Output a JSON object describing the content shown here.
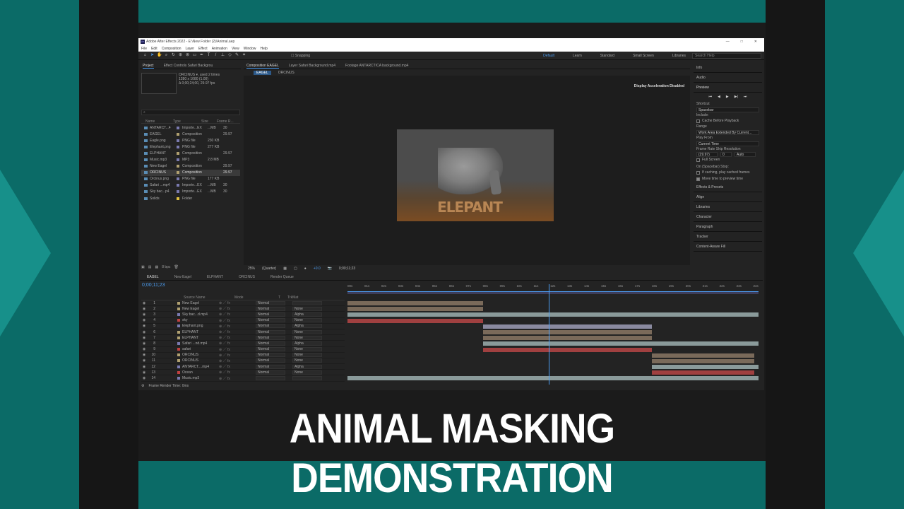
{
  "banner": "ANIMAL MASKING DEMONSTRATION",
  "window": {
    "title": "Adobe After Effects 2022 - E:\\New Folder (2)\\Animal.aep",
    "min": "—",
    "max": "□",
    "close": "✕"
  },
  "menu": [
    "File",
    "Edit",
    "Composition",
    "Layer",
    "Effect",
    "Animation",
    "View",
    "Window",
    "Help"
  ],
  "toolbar": {
    "snapping": "Snapping",
    "workspaces": [
      "Default",
      "Learn",
      "Standard",
      "Small Screen",
      "Libraries"
    ],
    "search_placeholder": "Search Help"
  },
  "project": {
    "tabs": [
      "Project",
      "Effect Controls Safari Backgrou"
    ],
    "info": [
      "ORCINUS ▾, used 2 times",
      "1280 x 1080 (1.00)",
      "Δ 0;00;24;00, 29.97 fps"
    ],
    "columns": [
      "Name",
      "Type",
      "Size",
      "Frame R..."
    ],
    "items": [
      {
        "name": "ANTARCT...4",
        "type": "Importe...EX",
        "size": "...MB",
        "fps": "30",
        "color": "#7a7ab0"
      },
      {
        "name": "EAGEL",
        "type": "Composition",
        "size": "",
        "fps": "29.97",
        "color": "#b0a070"
      },
      {
        "name": "Eagle.png",
        "type": "PNG file",
        "size": "230 KB",
        "fps": "",
        "color": "#7a7ab0"
      },
      {
        "name": "Elephant.png",
        "type": "PNG file",
        "size": "277 KB",
        "fps": "",
        "color": "#7a7ab0"
      },
      {
        "name": "ELPHANT",
        "type": "Composition",
        "size": "",
        "fps": "29.97",
        "color": "#b0a070"
      },
      {
        "name": "Music.mp3",
        "type": "MP3",
        "size": "2.8 MB",
        "fps": "",
        "color": "#7a7ab0"
      },
      {
        "name": "New Eagel",
        "type": "Composition",
        "size": "",
        "fps": "29.97",
        "color": "#b0a070"
      },
      {
        "name": "ORCINUS",
        "type": "Composition",
        "size": "",
        "fps": "29.97",
        "color": "#b0a070"
      },
      {
        "name": "Orcinus.png",
        "type": "PNG file",
        "size": "177 KB",
        "fps": "",
        "color": "#7a7ab0"
      },
      {
        "name": "Safari ...mp4",
        "type": "Importe...EX",
        "size": "...MB",
        "fps": "30",
        "color": "#7a7ab0"
      },
      {
        "name": "Sky bac...p4",
        "type": "Importe...EX",
        "size": "...MB",
        "fps": "30",
        "color": "#7a7ab0"
      },
      {
        "name": "Solids",
        "type": "Folder",
        "size": "",
        "fps": "",
        "color": "#e0c040"
      }
    ],
    "bpc": "8 bpc"
  },
  "composition": {
    "tabs": [
      "Composition EAGEL",
      "Layer Safari Background.mp4",
      "Footage ANTARCTICA background.mp4"
    ],
    "subtabs": [
      "EAGEL",
      "ORCINUS"
    ],
    "accel": "Display Acceleration Disabled",
    "scene_text": "ELEPANT",
    "zoom": "25%",
    "resolution": "(Quarter)",
    "exposure": "+0.0",
    "timecode": "0;00;11;23"
  },
  "right": {
    "sections": [
      "Info",
      "Audio",
      "Preview"
    ],
    "shortcut_label": "Shortcut",
    "shortcut": "Spacebar",
    "include": "Include:",
    "cache": "Cache Before Playback",
    "range_label": "Range",
    "range": "Work Area Extended By Current...",
    "playfrom_label": "Play From",
    "playfrom": "Current Time",
    "fr_label": "Frame Rate  Skip  Resolution",
    "fr": "(29.97)",
    "skip": "0",
    "res": "Auto",
    "fullscreen": "Full Screen",
    "onstop": "On (Spacebar) Stop:",
    "ifcache": "If caching, play cached frames",
    "movetime": "Move time to preview time",
    "panels": [
      "Effects & Presets",
      "Align",
      "Libraries",
      "Character",
      "Paragraph",
      "Tracker",
      "Content-Aware Fill"
    ]
  },
  "timeline": {
    "tabs": [
      "EAGEL",
      "New Eagel",
      "ELPHANT",
      "ORCINUS",
      "Render Queue"
    ],
    "timecode": "0;00;11;23",
    "ruler": [
      "00s",
      "01s",
      "02s",
      "03s",
      "04s",
      "05s",
      "06s",
      "07s",
      "08s",
      "09s",
      "10s",
      "11s",
      "12s",
      "13s",
      "14s",
      "15s",
      "16s",
      "17s",
      "18s",
      "19s",
      "20s",
      "21s",
      "22s",
      "23s",
      "24s"
    ],
    "columns": [
      "Source Name",
      "Mode",
      "T",
      "TrkMat"
    ],
    "layers": [
      {
        "n": "1",
        "name": "New Eagel",
        "mode": "Normal",
        "trk": "",
        "color": "#b0a070",
        "bar": {
          "s": 0,
          "e": 0.33,
          "c": "#7a6a5a"
        }
      },
      {
        "n": "2",
        "name": "New Eagel",
        "mode": "Normal",
        "trk": "None",
        "color": "#b0a070",
        "bar": {
          "s": 0,
          "e": 0.33,
          "c": "#7a6a5a"
        }
      },
      {
        "n": "3",
        "name": "Sky bac...d.mp4",
        "mode": "Normal",
        "trk": "Alpha",
        "color": "#7a7ab0",
        "bar": {
          "s": 0,
          "e": 1,
          "c": "#8a9a9a"
        }
      },
      {
        "n": "4",
        "name": "sky",
        "mode": "Normal",
        "trk": "None",
        "color": "#c04040",
        "bar": {
          "s": 0,
          "e": 0.33,
          "c": "#a04040"
        }
      },
      {
        "n": "5",
        "name": "Elephant.png",
        "mode": "Normal",
        "trk": "Alpha",
        "color": "#7a7ab0",
        "bar": {
          "s": 0.33,
          "e": 0.74,
          "c": "#8a8aa0"
        }
      },
      {
        "n": "6",
        "name": "ELPHANT",
        "mode": "Normal",
        "trk": "None",
        "color": "#b0a070",
        "bar": {
          "s": 0.33,
          "e": 0.74,
          "c": "#7a6a5a"
        }
      },
      {
        "n": "7",
        "name": "ELPHANT",
        "mode": "Normal",
        "trk": "None",
        "color": "#b0a070",
        "bar": {
          "s": 0.33,
          "e": 0.74,
          "c": "#7a6a5a"
        }
      },
      {
        "n": "8",
        "name": "Safari ...nd.mp4",
        "mode": "Normal",
        "trk": "Alpha",
        "color": "#7a7ab0",
        "bar": {
          "s": 0.33,
          "e": 1,
          "c": "#8a9a9a"
        }
      },
      {
        "n": "9",
        "name": "safari",
        "mode": "Normal",
        "trk": "None",
        "color": "#c04040",
        "bar": {
          "s": 0.33,
          "e": 0.74,
          "c": "#a04040"
        }
      },
      {
        "n": "10",
        "name": "ORCINUS",
        "mode": "Normal",
        "trk": "None",
        "color": "#b0a070",
        "bar": {
          "s": 0.74,
          "e": 0.99,
          "c": "#7a6a5a"
        }
      },
      {
        "n": "11",
        "name": "ORCINUS",
        "mode": "Normal",
        "trk": "None",
        "color": "#b0a070",
        "bar": {
          "s": 0.74,
          "e": 0.99,
          "c": "#7a6a5a"
        }
      },
      {
        "n": "12",
        "name": "ANTARCT....mp4",
        "mode": "Normal",
        "trk": "Alpha",
        "color": "#7a7ab0",
        "bar": {
          "s": 0.74,
          "e": 1,
          "c": "#8a9a9a"
        }
      },
      {
        "n": "13",
        "name": "Ocean",
        "mode": "Normal",
        "trk": "None",
        "color": "#c04040",
        "bar": {
          "s": 0.74,
          "e": 0.99,
          "c": "#a04040"
        }
      },
      {
        "n": "14",
        "name": "Music.mp3",
        "mode": "",
        "trk": "",
        "color": "#7a7ab0",
        "bar": {
          "s": 0,
          "e": 1,
          "c": "#8a9a9a"
        }
      }
    ],
    "render_time": "Frame Render Time: 0ms",
    "playhead": 0.49
  }
}
